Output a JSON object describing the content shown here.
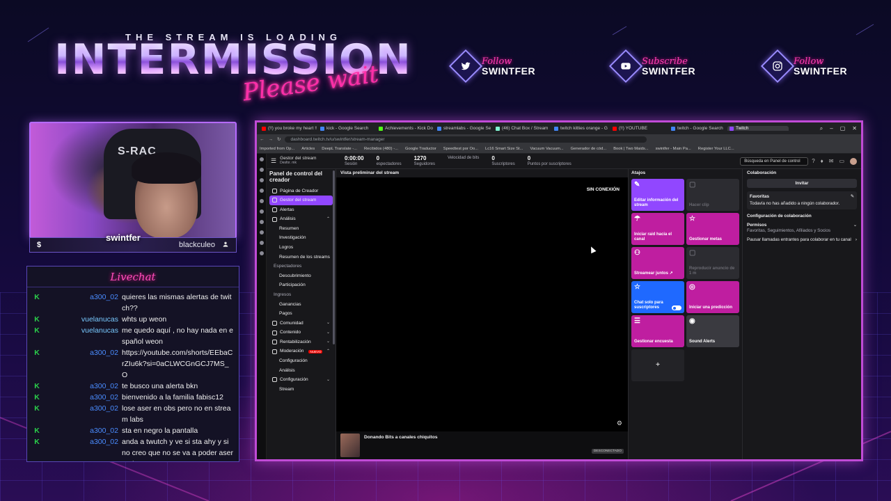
{
  "overlay": {
    "loading_text": "THE STREAM IS LOADING",
    "title": "INTERMISSION",
    "subtitle": "Please wait",
    "socials": [
      {
        "verb": "Follow",
        "name": "SWINTFER",
        "icon": "twitter-icon"
      },
      {
        "verb": "Subscribe",
        "name": "SWINTFER",
        "icon": "youtube-icon"
      },
      {
        "verb": "Follow",
        "name": "SWINTFER",
        "icon": "instagram-icon"
      }
    ],
    "cam": {
      "name": "swintfer",
      "chair_brand": "S-RAC",
      "handle": "blackculeo"
    },
    "colors": {
      "accent_pink": "#ff2fa8",
      "accent_purple": "#b66bff",
      "twitch_purple": "#9147ff"
    }
  },
  "chat": {
    "title": "Livechat",
    "messages": [
      {
        "user": "a300_02",
        "text": "quieres las mismas alertas de twitch??"
      },
      {
        "user": "vuelanucas",
        "text": "whts up weon"
      },
      {
        "user": "vuelanucas",
        "text": "me quedo aquí , no hay nada en español weon"
      },
      {
        "user": "a300_02",
        "text": "https://youtube.com/shorts/EEbaCrZIu6k?si=0aCLWCGnGCJ7MS_O"
      },
      {
        "user": "a300_02",
        "text": "te busco una alerta bkn"
      },
      {
        "user": "a300_02",
        "text": "bienvenido a la familia fabisc12"
      },
      {
        "user": "a300_02",
        "text": "lose aser en obs pero no en stream labs"
      },
      {
        "user": "a300_02",
        "text": "sta en negro la pantalla"
      },
      {
        "user": "a300_02",
        "text": "anda a twutch y ve si sta ahy y si no creo que no se va a poder aser nada"
      }
    ]
  },
  "browser": {
    "tabs": [
      "(!!) you broke my heart !!",
      "kick - Google Search",
      "Achievements - Kick Do",
      "streamlabs - Google Se",
      "(46) Chat Box / Stream",
      "twitch kitties orange - G",
      "(!!) YOUTUBE",
      "twitch - Google Search",
      "Twitch"
    ],
    "url": "dashboard.twitch.tv/u/swintfer/stream-manager",
    "bookmarks": [
      "Imported from Op...",
      "Articles",
      "DeepL Translate -...",
      "Recibidos (480) -...",
      "Google Traductor",
      "Speedtest por Oo...",
      "Lc16 Smart Size St...",
      "Vacuum Vacuum...",
      "Generador de cód...",
      "Book | Two Maids...",
      "swintfer - Main Pa...",
      "Register Your LLC..."
    ],
    "header": {
      "crumb": "Gestor del stream",
      "crumb_sub": "Desfor. mk",
      "stats": [
        {
          "value": "0:00:00",
          "label": "Sesión"
        },
        {
          "value": "0",
          "label": "espectadores"
        },
        {
          "value": "1270",
          "label": "Seguidores"
        },
        {
          "value": "",
          "label": "Velocidad de bits"
        },
        {
          "value": "0",
          "label": "Suscriptores"
        },
        {
          "value": "0",
          "label": "Puntos por suscriptores"
        }
      ],
      "search_placeholder": "Búsqueda en Panel de control"
    },
    "sidebar": {
      "title": "Panel de control del creador",
      "items": [
        {
          "label": "Página de Creador",
          "kind": "top"
        },
        {
          "label": "Gestor del stream",
          "kind": "active"
        },
        {
          "label": "Alertas",
          "kind": "top"
        },
        {
          "label": "Análisis",
          "kind": "top"
        },
        {
          "label": "Resumen",
          "kind": "sub"
        },
        {
          "label": "Investigación",
          "kind": "sub"
        },
        {
          "label": "Logros",
          "kind": "sub"
        },
        {
          "label": "Resumen de los streams",
          "kind": "sub"
        },
        {
          "label": "Espectadores",
          "kind": "cat"
        },
        {
          "label": "Descubrimiento",
          "kind": "sub"
        },
        {
          "label": "Participación",
          "kind": "sub"
        },
        {
          "label": "Ingresos",
          "kind": "cat"
        },
        {
          "label": "Ganancias",
          "kind": "sub"
        },
        {
          "label": "Pagos",
          "kind": "sub"
        },
        {
          "label": "Comunidad",
          "kind": "top"
        },
        {
          "label": "Contenido",
          "kind": "top"
        },
        {
          "label": "Rentabilización",
          "kind": "top"
        },
        {
          "label": "Moderación",
          "kind": "top",
          "badge": "NUEVO"
        },
        {
          "label": "Configuración",
          "kind": "sub"
        },
        {
          "label": "Análisis",
          "kind": "sub"
        },
        {
          "label": "Configuración",
          "kind": "top"
        },
        {
          "label": "Stream",
          "kind": "sub"
        }
      ]
    },
    "preview": {
      "title": "Vista preliminar del stream",
      "offline": "SIN CONEXIÓN",
      "footer_title": "Donando Bits a canales chiquitos",
      "footer_status": "DESCONECTADO"
    },
    "atajos": {
      "title": "Atajos",
      "tiles": [
        {
          "label": "Editar información del stream",
          "style": "purple",
          "icon": "pencil-icon"
        },
        {
          "label": "Hacer clip",
          "style": "grey",
          "icon": "clip-icon"
        },
        {
          "label": "Iniciar raid hacia el canal",
          "style": "magenta",
          "icon": "raid-icon"
        },
        {
          "label": "Gestionar metas",
          "style": "magenta",
          "icon": "star-icon"
        },
        {
          "label": "Streamear juntos ↗",
          "style": "magenta",
          "icon": "add-user-icon"
        },
        {
          "label": "Reproducir anuncio de 1 m",
          "style": "grey",
          "icon": "ad-icon"
        },
        {
          "label": "Chat solo para suscriptores",
          "style": "blue",
          "icon": "star-icon"
        },
        {
          "label": "Iniciar una predicción",
          "style": "magenta",
          "icon": "prediction-icon"
        },
        {
          "label": "Gestionar encuesta",
          "style": "magenta",
          "icon": "poll-icon"
        },
        {
          "label": "Sound Alerts",
          "style": "grey2",
          "icon": "sound-alerts-icon"
        }
      ],
      "add_label": "+"
    },
    "collab": {
      "title": "Colaboración",
      "invite": "Invitar",
      "fav_title": "Favoritas",
      "fav_text": "Todavía no has añadido a ningún colaborador.",
      "config_title": "Configuración de colaboración",
      "perm_title": "Permisos",
      "perm_text": "Favoritas, Seguimientos, Afiliados y Socios",
      "pause_text": "Pausar llamadas entrantes para colaborar en tu canal"
    }
  }
}
